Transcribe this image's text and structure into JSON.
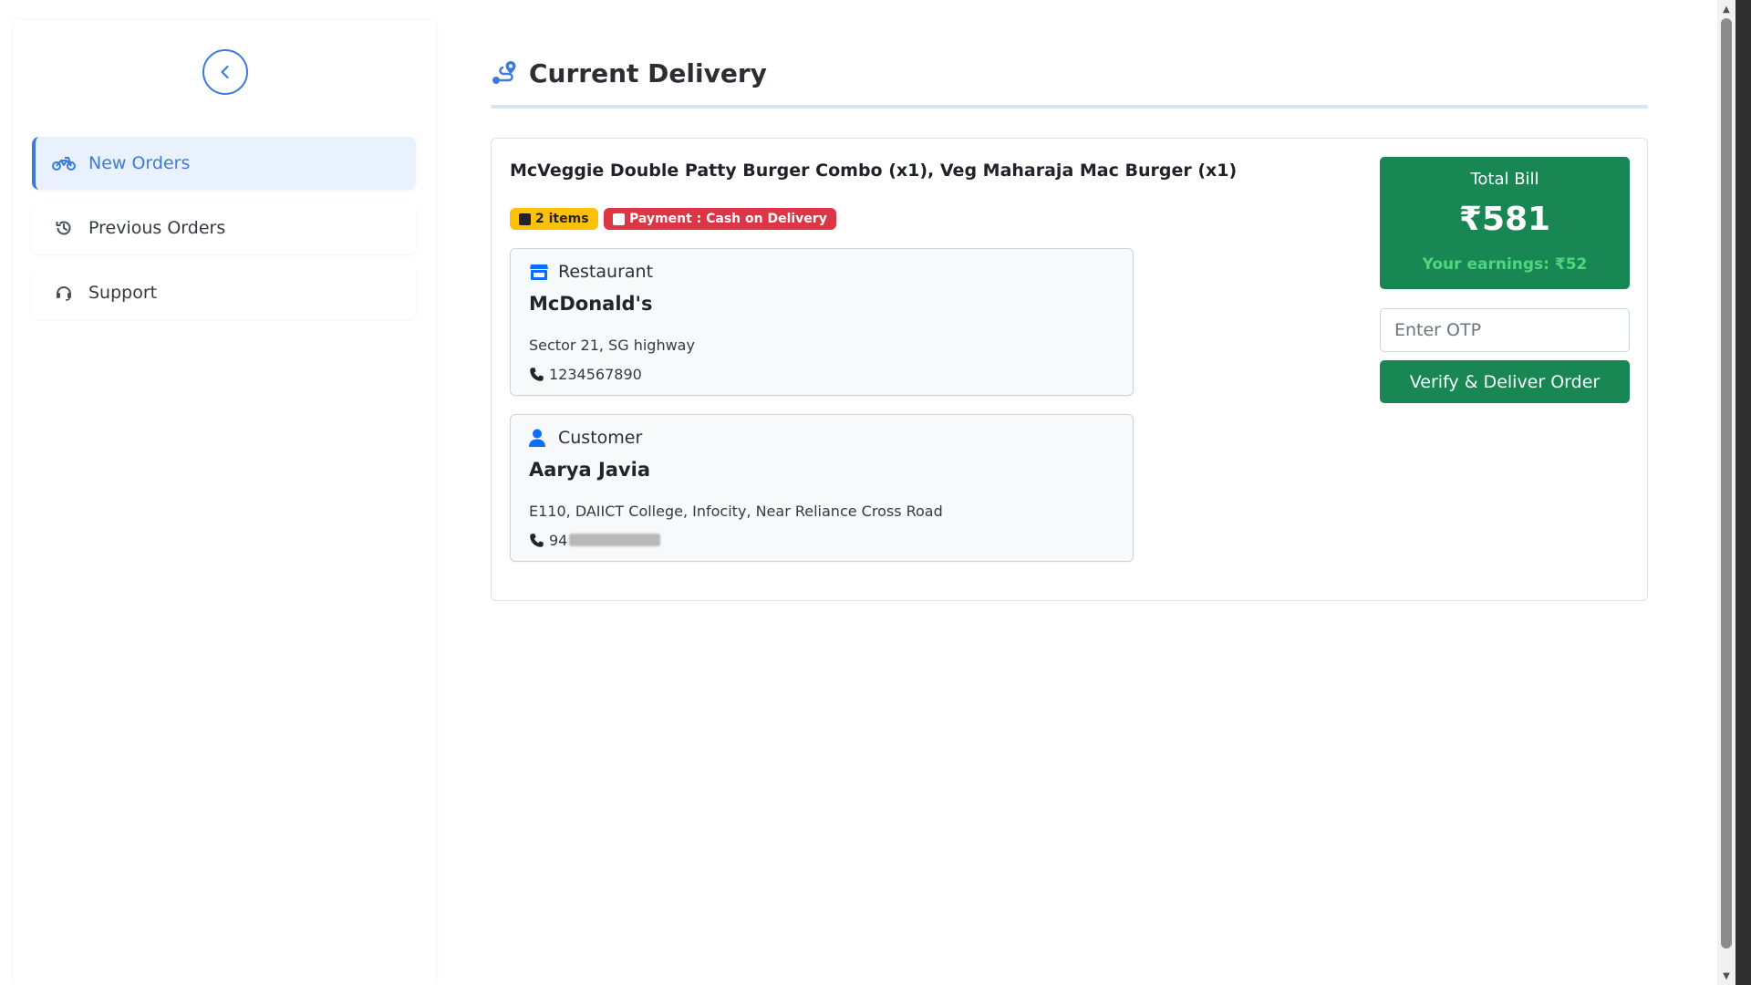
{
  "sidebar": {
    "collapse_icon": "chevron-left-icon",
    "items": [
      {
        "label": "New Orders",
        "icon": "motorcycle-icon",
        "active": true
      },
      {
        "label": "Previous Orders",
        "icon": "history-icon",
        "active": false
      },
      {
        "label": "Support",
        "icon": "headset-icon",
        "active": false
      }
    ]
  },
  "main": {
    "title": "Current Delivery",
    "title_icon": "route-icon"
  },
  "order": {
    "title": "McVeggie Double Patty Burger Combo (x1), Veg Maharaja Mac Burger (x1)",
    "items_badge": "2 items",
    "payment_badge": "Payment : Cash on Delivery",
    "restaurant": {
      "heading": "Restaurant",
      "icon": "store-icon",
      "name": "McDonald's",
      "address": "Sector 21, SG highway",
      "phone": "1234567890"
    },
    "customer": {
      "heading": "Customer",
      "icon": "user-icon",
      "name": "Aarya Javia",
      "address": "E110, DAIICT College, Infocity, Near Reliance Cross Road",
      "phone_prefix": "94"
    },
    "bill": {
      "label": "Total Bill",
      "amount": "₹581",
      "earnings": "Your earnings: ₹52"
    },
    "otp": {
      "placeholder": "Enter OTP",
      "value": ""
    },
    "verify_label": "Verify & Deliver Order"
  },
  "colors": {
    "primary": "#3d7bd9",
    "success": "#198754",
    "warning": "#ffc107",
    "danger": "#dc3545",
    "earnings_text": "#4fd67f"
  }
}
